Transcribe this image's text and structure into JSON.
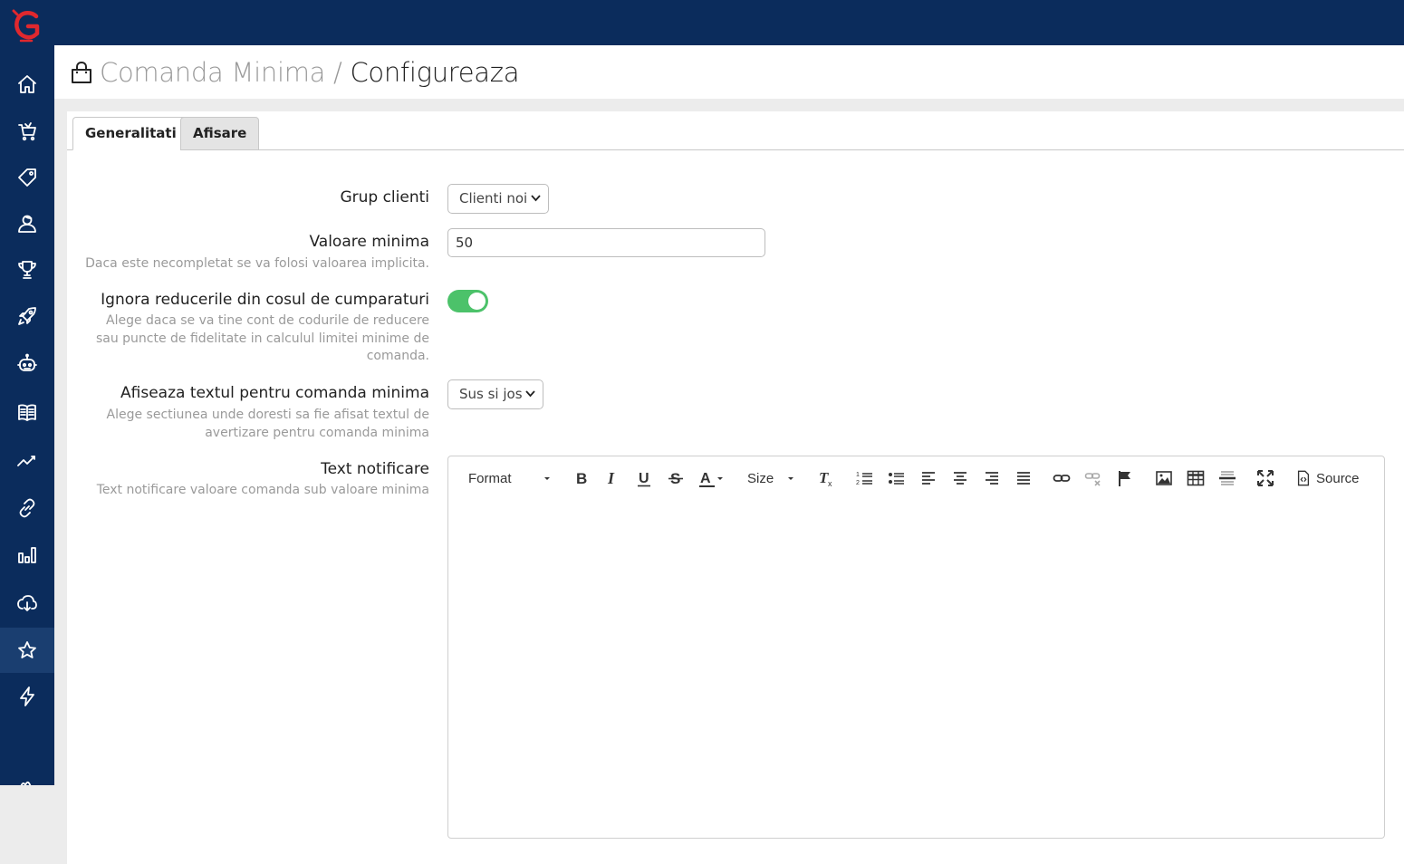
{
  "sidebar": {
    "items": [
      {
        "icon": "home-icon",
        "active": false
      },
      {
        "icon": "cart-icon",
        "active": false
      },
      {
        "icon": "tag-icon",
        "active": false
      },
      {
        "icon": "users-icon",
        "active": false
      },
      {
        "icon": "trophy-icon",
        "active": false
      },
      {
        "icon": "rocket-icon",
        "active": false
      },
      {
        "icon": "robot-icon",
        "active": false
      },
      {
        "icon": "book-icon",
        "active": false
      },
      {
        "icon": "trend-icon",
        "active": false
      },
      {
        "icon": "link-icon",
        "active": false
      },
      {
        "icon": "bar-chart-icon",
        "active": false
      },
      {
        "icon": "cloud-download-icon",
        "active": false
      },
      {
        "icon": "star-icon",
        "active": true
      },
      {
        "icon": "bolt-icon",
        "active": false
      }
    ]
  },
  "header": {
    "breadcrumb": "Comanda Minima",
    "separator": " / ",
    "current": "Configureaza"
  },
  "tabs": [
    {
      "label": "Generalitati",
      "active": true
    },
    {
      "label": "Afisare",
      "active": false
    }
  ],
  "form": {
    "group": {
      "label": "Grup clienti",
      "value": "Clienti noi"
    },
    "min_value": {
      "label": "Valoare minima",
      "hint": "Daca este necompletat se va folosi valoarea implicita.",
      "value": "50"
    },
    "ignore_discounts": {
      "label": "Ignora reducerile din cosul de cumparaturi",
      "hint": "Alege daca se va tine cont de codurile de reducere sau puncte de fidelitate in calculul limitei minime de comanda.",
      "enabled": true
    },
    "display_position": {
      "label": "Afiseaza textul pentru comanda minima",
      "hint": "Alege sectiunea unde doresti sa fie afisat textul de avertizare pentru comanda minima",
      "value": "Sus si jos"
    },
    "notification_text": {
      "label": "Text notificare",
      "hint": "Text notificare valoare comanda sub valoare minima",
      "value": ""
    }
  },
  "editor": {
    "format_label": "Format",
    "size_label": "Size",
    "source_label": "Source"
  },
  "colors": {
    "navy": "#0b2c5c",
    "toggle_on": "#4cc26a",
    "accent_red": "#e0282e"
  }
}
